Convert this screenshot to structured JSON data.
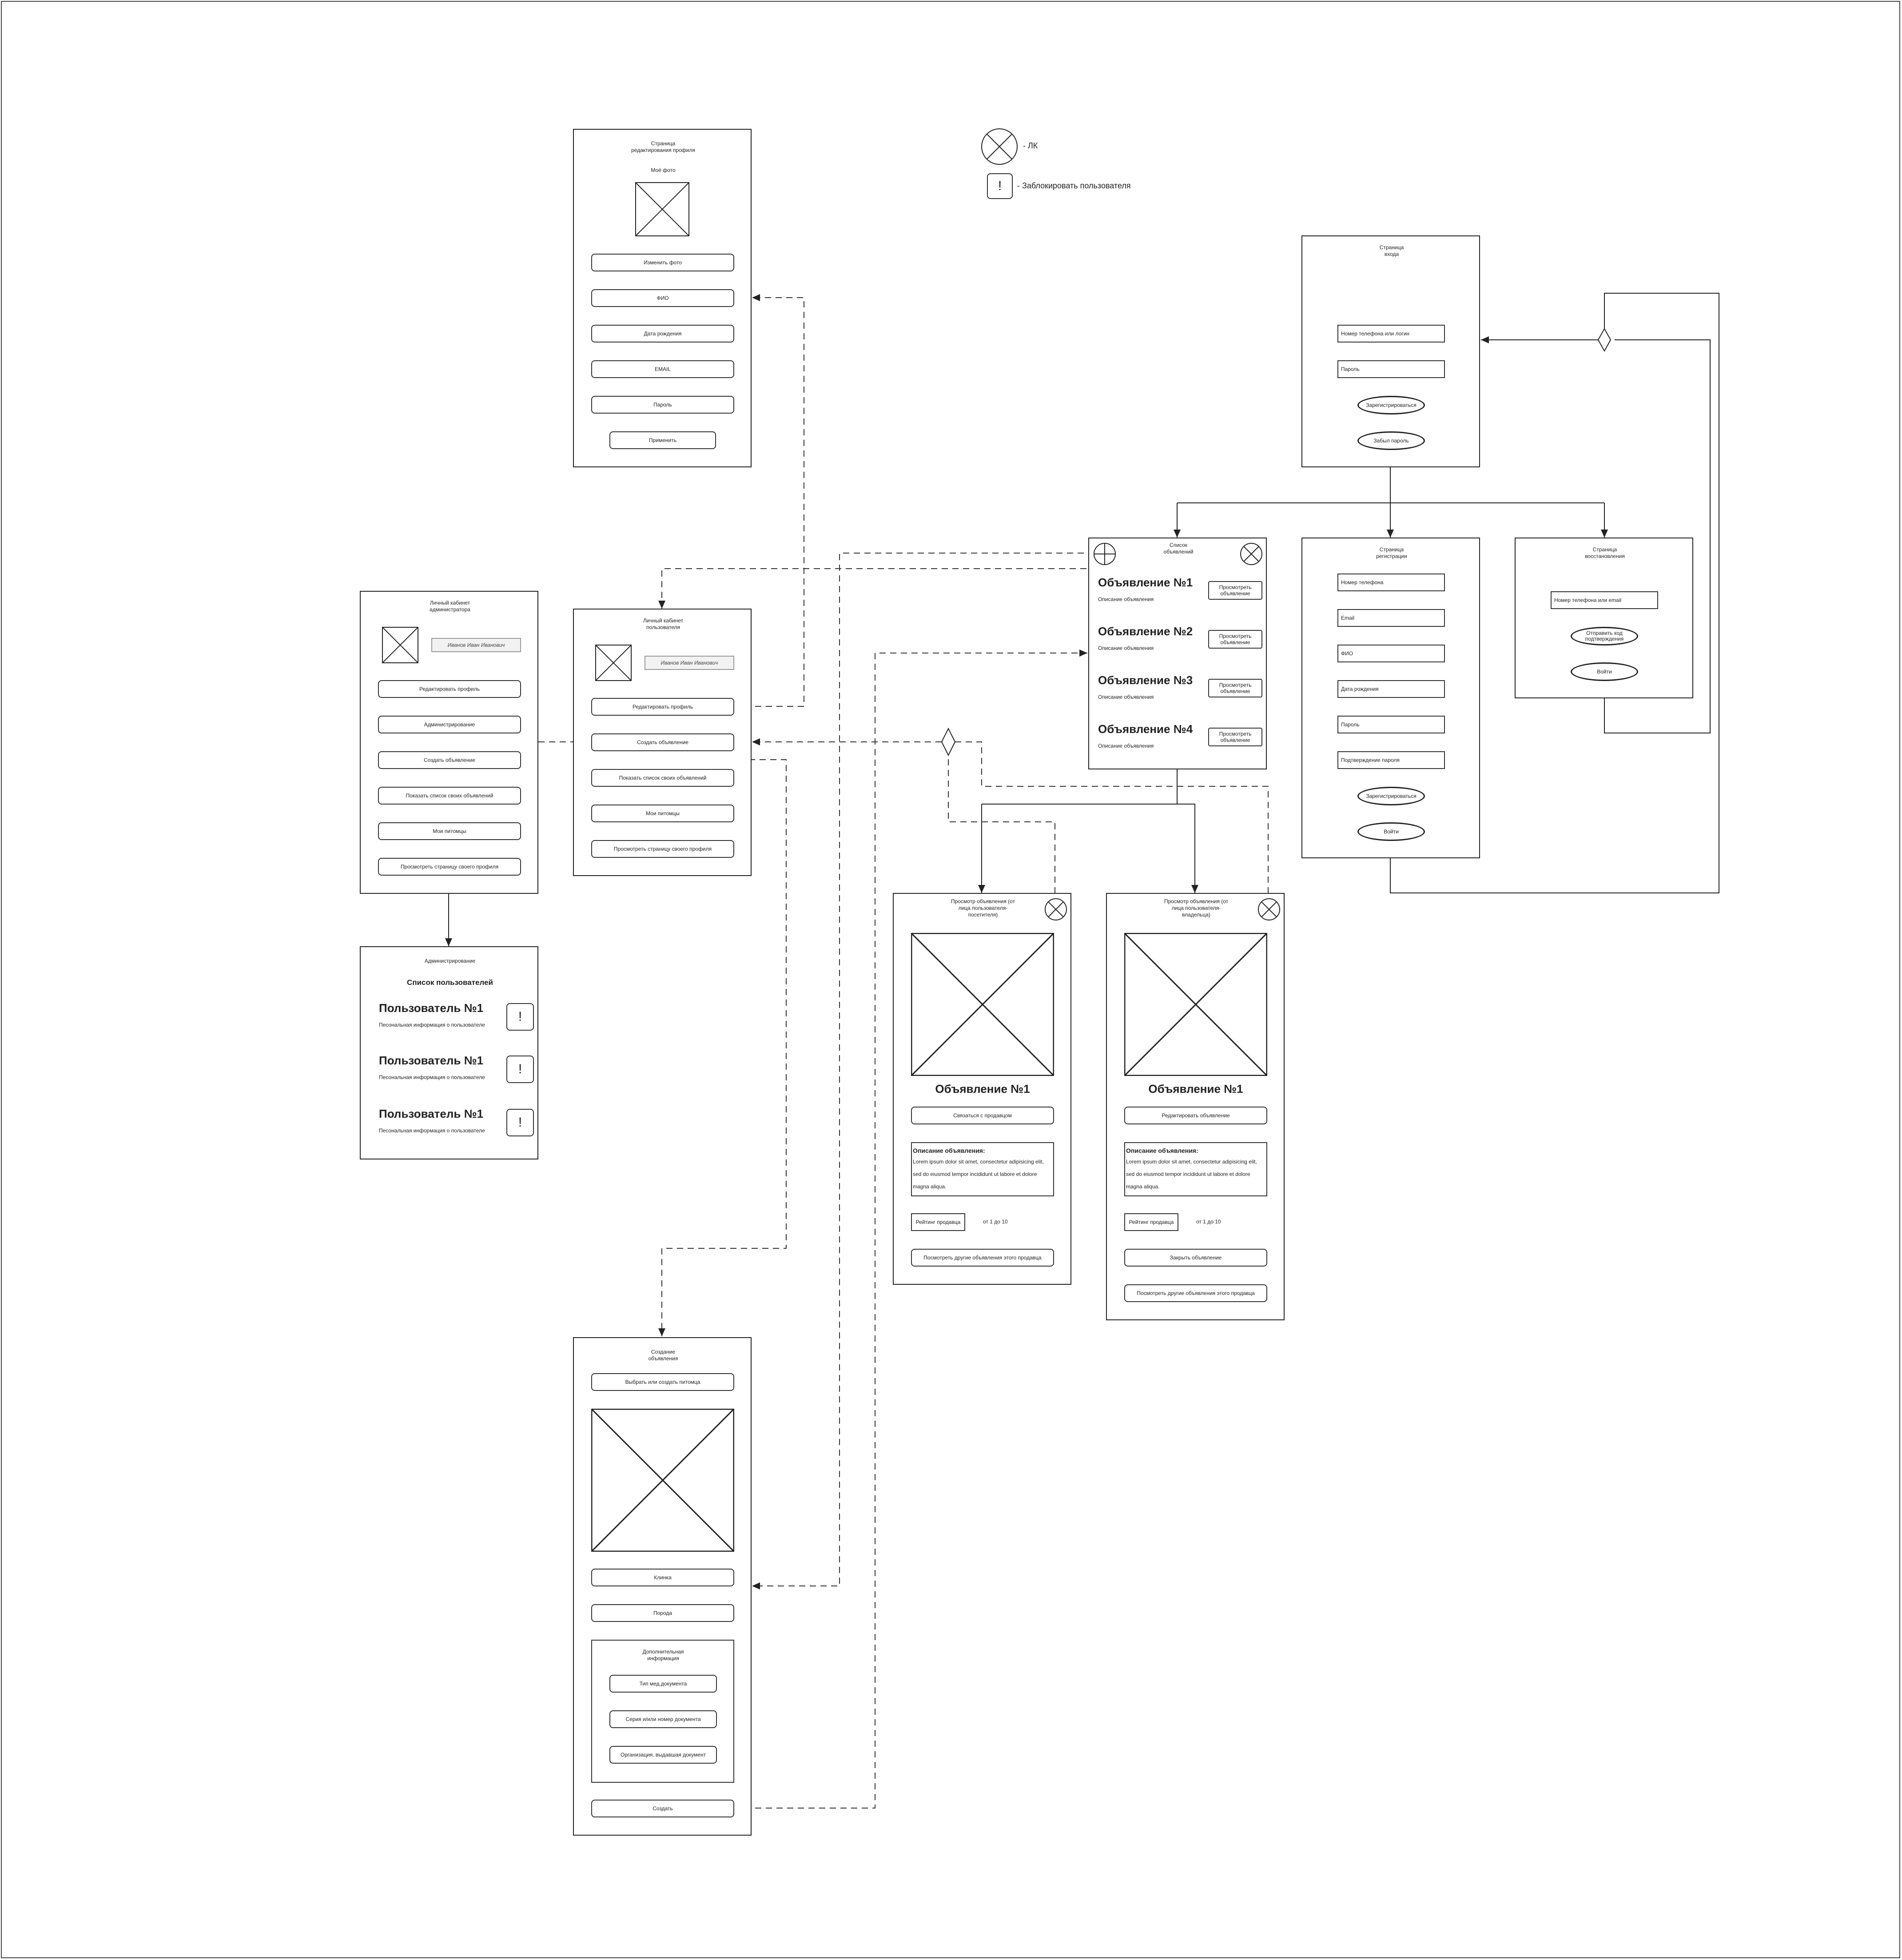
{
  "legend": {
    "lk_text": "- ЛК",
    "block_text": "- Заблокировать пользователя",
    "block_icon": "!"
  },
  "edit_profile": {
    "title": "Страница\nредактирования профиля",
    "photo_label": "Моё фото",
    "buttons": [
      "Изменить фото",
      "ФИО",
      "Дата рождения",
      "EMAIL",
      "Пароль"
    ],
    "apply": "Применить"
  },
  "login": {
    "title": "Страница\nвхода",
    "fields": [
      "Номер телефона или логин",
      "Пароль"
    ],
    "register": "Зарегистрироваться",
    "forgot": "Забыл пароль"
  },
  "ad_list": {
    "title": "Список\nобъявлений",
    "items": [
      {
        "title": "Объявление №1",
        "desc": "Описание объявления",
        "button": "Просмотреть\nобъявление"
      },
      {
        "title": "Объявление №2",
        "desc": "Описание объявления",
        "button": "Просмотреть\nобъявление"
      },
      {
        "title": "Объявление №3",
        "desc": "Описание объявления",
        "button": "Просмотреть\nобъявление"
      },
      {
        "title": "Объявление №4",
        "desc": "Описание объявления",
        "button": "Просмотреть\nобъявление"
      }
    ]
  },
  "registration": {
    "title": "Страница\nрегистрации",
    "fields": [
      "Номер телефона",
      "Email",
      "ФИО",
      "Дата рождения",
      "Пароль",
      "Подтверждение пароля"
    ],
    "register": "Зарегистрироваться",
    "login": "Войти"
  },
  "recovery": {
    "title": "Страница\nвосстановления",
    "field": "Номер телефона или email",
    "send_code": "Отправить код\nподтверждения",
    "login": "Войти"
  },
  "admin_cabinet": {
    "title": "Личный кабинет\nадминистратора",
    "name": "Иванов Иван Иванович",
    "buttons": [
      "Редактировать профиль",
      "Администрирование",
      "Создать объявление",
      "Показать список своих объявлений",
      "Мои питомцы",
      "Просмотреть страницу своего профиля"
    ]
  },
  "user_cabinet": {
    "title": "Личный кабинет\nпользователя",
    "name": "Иванов Иван Иванович",
    "buttons": [
      "Редактировать профиль",
      "Создать объявление",
      "Показать список своих объявлений",
      "Мои питомцы",
      "Просмотреть страницу своего профиля"
    ]
  },
  "admin_panel": {
    "title": "Администрирование",
    "list_title": "Список пользователей",
    "users": [
      {
        "name": "Пользователь №1",
        "info": "Песональная информация о пользователе"
      },
      {
        "name": "Пользователь №1",
        "info": "Песональная информация о пользователе"
      },
      {
        "name": "Пользователь №1",
        "info": "Песональная информация о пользователе"
      }
    ]
  },
  "ad_view_visitor": {
    "title": "Просмотр объявления (от\nлица пользователя-\nпосетителя)",
    "ad_title": "Объявление №1",
    "contact": "Связаться с продавцом",
    "desc_heading": "Описание объявления:",
    "desc_text": "Lorem ipsum dolor sit amet, consectetur adipisicing elit, sed do eiusmod tempor incididunt ut labore et dolore magna aliqua.",
    "rating_label": "Рейтинг продавца",
    "rating_value": "от 1 до 10",
    "other_ads": "Посмотреть другие объявления этого продавца"
  },
  "ad_view_owner": {
    "title": "Просмотр объявления (от\nлица пользователя-\nвладельца)",
    "ad_title": "Объявление №1",
    "edit": "Редактировать объявление",
    "desc_heading": "Описание объявления:",
    "desc_text": "Lorem ipsum dolor sit amet, consectetur adipisicing elit, sed do eiusmod tempor incididunt ut labore et dolore magna aliqua.",
    "rating_label": "Рейтинг продавца",
    "rating_value": "от 1 до 10",
    "close": "Закрыть объявление",
    "other_ads": "Посмотреть другие объявления этого продавца"
  },
  "create_ad": {
    "title": "Создание\nобъявления",
    "pick_pet": "Выбрать или создать питомца",
    "clinic": "Клинка",
    "breed": "Порода",
    "extra_title": "Дополнительная\nинформация",
    "extra_buttons": [
      "Тип мед.документа",
      "Серия и/или номер документа",
      "Организация, выдавшая документ"
    ],
    "create": "Создать"
  }
}
